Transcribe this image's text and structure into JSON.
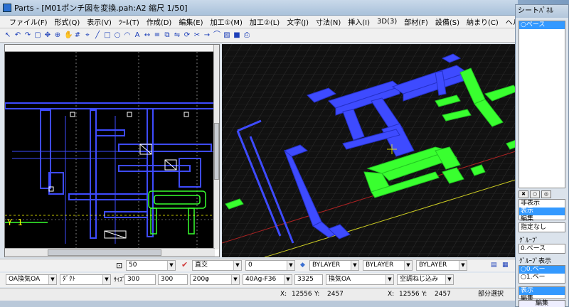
{
  "window": {
    "title": "Parts - [M01ポンチ図を変換.pah:A2 縮尺 1/50]"
  },
  "menu": [
    "ファイル(F)",
    "形式(Q)",
    "表示(V)",
    "ﾂｰﾙ(T)",
    "作成(D)",
    "編集(E)",
    "加工①(M)",
    "加工②(L)",
    "文字(J)",
    "寸法(N)",
    "挿入(I)",
    "3D(3)",
    "部材(F)",
    "設備(S)",
    "納まり(C)",
    "ヘルプ"
  ],
  "toolbar_icons": [
    "pointer-icon",
    "undo-icon",
    "redo-icon",
    "select-icon",
    "move-icon",
    "zoom-icon",
    "pan-icon",
    "grid-icon",
    "snap-icon",
    "line-icon",
    "rect-icon",
    "circle-icon",
    "arc-icon",
    "text-icon",
    "dimension-icon",
    "layer-icon",
    "copy-icon",
    "mirror-icon",
    "rotate-icon",
    "trim-icon",
    "extend-icon",
    "fillet-icon",
    "hatch-icon",
    "block-icon",
    "print-icon"
  ],
  "view2d": {
    "y_label": "Y 1"
  },
  "prop_row_1": {
    "scale_value": "50",
    "line_type": "直交",
    "angle": "0",
    "color": "BYLAYER",
    "linetype": "BYLAYER",
    "lineweight": "BYLAYER"
  },
  "prop_row_2": {
    "system": "OA換気OA",
    "kind": "ﾀﾞｸﾄ",
    "size_label": "ｻｲｽﾞ",
    "width": "300",
    "height": "300",
    "diameter": "200φ",
    "spec": "40Ag-F36",
    "length": "3325",
    "usage": "換気OA",
    "joint": "空調ねじ込み"
  },
  "status": {
    "x_label": "X:",
    "x_value": "12556",
    "y_label": "Y:",
    "y_value": "2457",
    "x_label_2": "X:",
    "x_value_2": "12556",
    "y_label_2": "Y:",
    "y_value_2": "2457",
    "mode": "部分選択"
  },
  "sheet_panel": {
    "title": "シートﾊﾟﾈﾙ",
    "sheets": [
      "○ベース"
    ],
    "modes": [
      "非表示",
      "表示",
      "編集"
    ],
    "selected_mode": "表示",
    "filter": "指定なし",
    "group_label": "ｸﾞﾙｰﾌﾟ",
    "group_value": "0.ベース",
    "group_display_label": "ｸﾞﾙｰﾌﾟ表示",
    "groups": [
      "○0.ベー",
      "○1.ベー"
    ],
    "modes_2": [
      "表示",
      "編集"
    ],
    "edit_button": "編集"
  },
  "colors": {
    "duct_blue": "#3e4bff",
    "duct_green": "#39ff2f",
    "canvas_bg": "#000000",
    "yellow_grid": "#ffff00"
  }
}
